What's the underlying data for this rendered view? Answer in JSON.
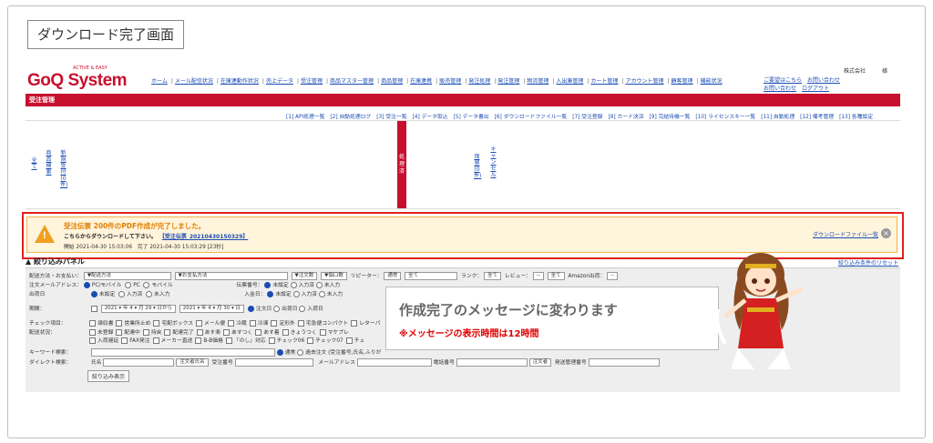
{
  "page_label": "ダウンロード完了画面",
  "logo": {
    "text": "GoQ System",
    "tagline": "ACTIVE & EASY"
  },
  "top_nav": [
    "ホーム",
    "メール配信状況",
    "在庫連動作状況",
    "売上データ",
    "受注管理",
    "商品マスター管理",
    "商品管理",
    "在庫連携",
    "販売管理",
    "発注処理",
    "発注管理",
    "物流管理",
    "入出庫管理",
    "カート管理",
    "アカウント管理",
    "顧客管理",
    "機能状況"
  ],
  "top_right": {
    "company": "株式会社　　　様",
    "links": [
      "ご要望はこちら",
      "お問い合わせ",
      "お問い合わせ",
      "ログアウト"
    ]
  },
  "red_bar_title": "受注管理",
  "sub_nav": [
    "[1] API処理一覧",
    "[2] 自動処理ログ",
    "[3] 受注一覧",
    "[4] データ取込",
    "[5] データ書出",
    "[6] ダウンロードファイル一覧",
    "[7] 受注登録",
    "[8] カード決済",
    "[9] 完結待機一覧",
    "[10] ライセンスキー一覧",
    "[11] 自動処理",
    "[12] 備考管理",
    "[13] 各種設定"
  ],
  "status_columns": [
    "全て",
    "商品検索",
    "新規受付(0件)",
    "処理済",
    "保留(0件)",
    "キャンセル"
  ],
  "notice": {
    "title": "受注伝票 200件のPDF作成が完了しました。",
    "line": "こちらからダウンロードして下さい。",
    "file_link": "【受注伝票_20210430150329】",
    "time": "開始 2021-04-30 15:03:06　完了 2021-04-30 15:03:29 [23秒]",
    "download_link": "ダウンロードファイル一覧",
    "close_icon": "close-icon"
  },
  "panel": {
    "title": "絞り込みパネル",
    "reset": "絞り込み条件のリセット"
  },
  "form": {
    "r1": "配送方法・お支払い：",
    "r1_sel1": "▼配送方法",
    "r1_sel2": "▼お支払方法",
    "r1_sel3": "▼注文数",
    "r1_sel4": "▼個口数",
    "r1_review": "リピーター：",
    "r1_sel5": "通常",
    "r1_sel6": "全て",
    "r1_rank": "ランク：",
    "r1_sel7": "全て",
    "r1_review2": "レビュー：",
    "r1_sel8": "--",
    "r1_sel9": "全て",
    "r1_amazon": "Amazon出荷：",
    "r1_sel10": "--",
    "r2": "注文メールアドレス：",
    "r2_opts": [
      "PC/モバイル",
      "PC",
      "モバイル"
    ],
    "r2_label2": "伝票番号：",
    "r2_opts2": [
      "未設定",
      "入力済",
      "未入力"
    ],
    "r3": "出荷日",
    "r3_opts": [
      "未設定",
      "入力済",
      "未入力"
    ],
    "r3_label2": "入金日：",
    "r3_opts2": [
      "未設定",
      "入力済",
      "未入力"
    ],
    "r4": "期間：",
    "r4_from": "2021 ▾ 年 4 ▾ 月 29 ▾ 日から",
    "r4_to": "2021 ▾ 年 4 ▾ 月 30 ▾ 日",
    "r4_opts": [
      "注文日",
      "出荷日",
      "入荷日"
    ],
    "r5": "チェック項目：",
    "r5_opts": [
      "領収書",
      "営業所止め",
      "宅配ボックス",
      "メール便",
      "冷蔵",
      "冷凍",
      "定形外",
      "宅急便コンパクト",
      "レターパ"
    ],
    "r6": "配送状況：",
    "r6_opts": [
      "未登録",
      "配達中",
      "持戻",
      "配達完了",
      "あす楽",
      "あすつく",
      "あす着",
      "きょうつく",
      "マケプレ"
    ],
    "r7_opts": [
      "入荷遅延",
      "FAX発注",
      "メーカー直送",
      "B-B価格",
      "「のし」対応",
      "チェック06",
      "チェック07",
      "チェ"
    ],
    "r8": "キーワード検索：",
    "r8_opts": [
      "通常",
      "過去注文 (受注番号,氏名,ふりが"
    ],
    "r9": "ダイレクト検索：",
    "r9_name": "氏名",
    "r9_sel": "注文者氏名",
    "r9_order": "受注番号",
    "r9_mail": "メールアドレス",
    "r9_tel": "電話番号",
    "r9_sel2": "注文者",
    "r9_ship": "発送管理番号",
    "submit": "絞り込み表示"
  },
  "bubble": {
    "message": "作成完了のメッセージに変わります",
    "note": "※メッセージの表示時間は12時間"
  },
  "colors": {
    "brand_red": "#c8102e",
    "notice_border": "#e02020",
    "notice_bg": "#fff4dc",
    "link": "#1a4db3"
  }
}
